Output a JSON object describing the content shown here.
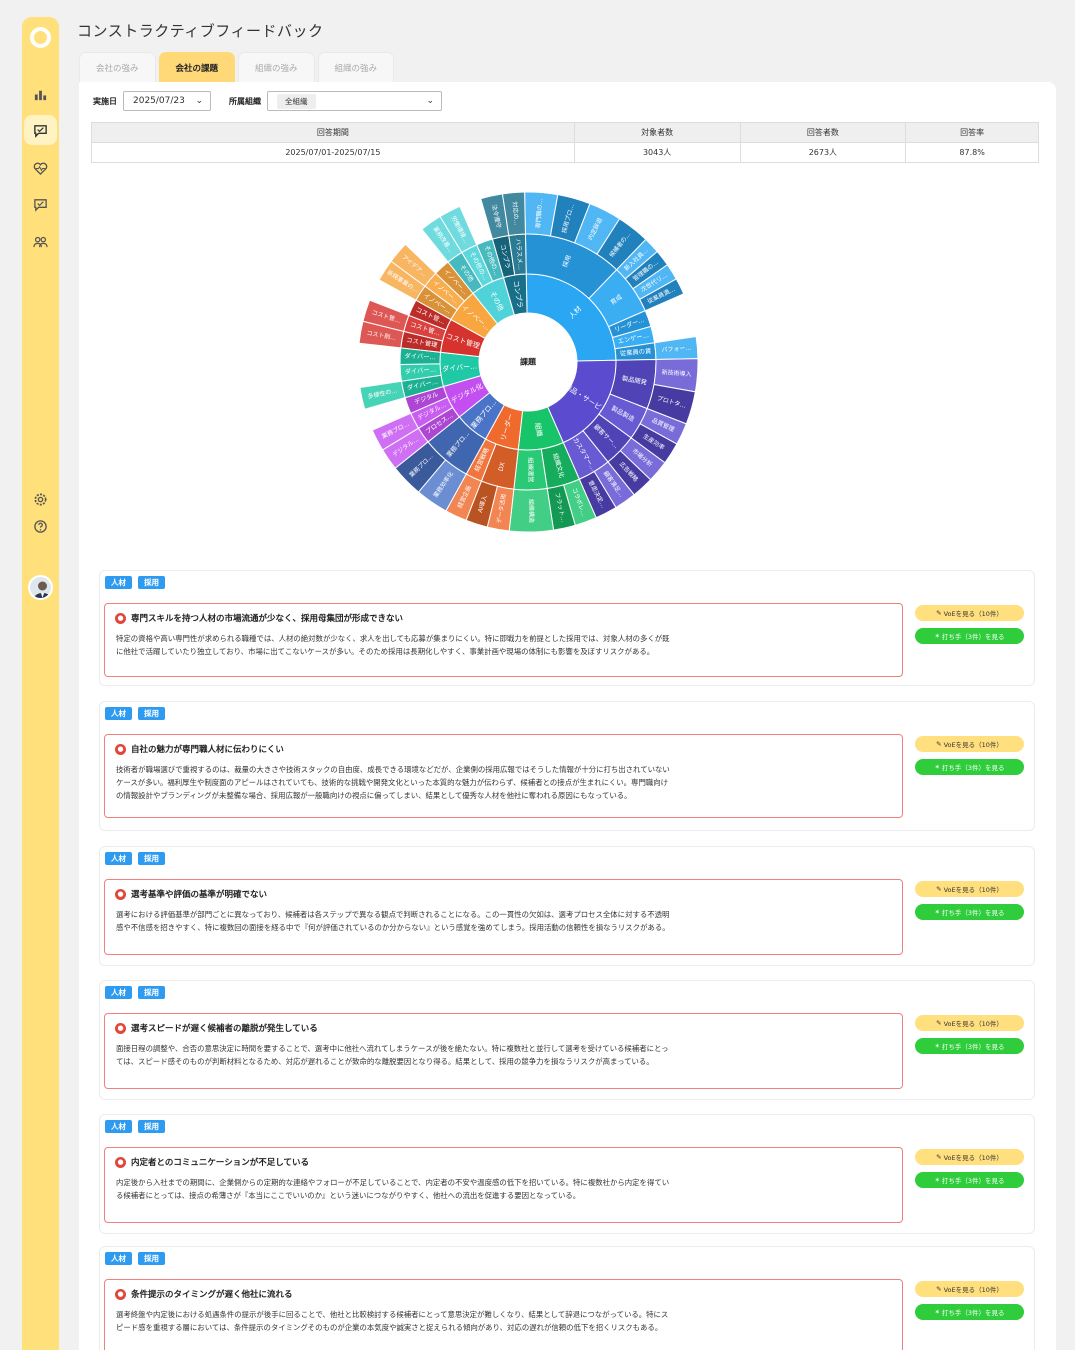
{
  "page_title": "コンストラクティブフィードバック",
  "tabs": [
    {
      "label": "会社の強み",
      "active": false
    },
    {
      "label": "会社の課題",
      "active": true
    },
    {
      "label": "組織の強み",
      "active": false
    },
    {
      "label": "組織の強み",
      "active": false
    }
  ],
  "filters": {
    "date_label": "実施日",
    "date_value": "2025/07/23",
    "org_label": "所属組織",
    "org_value": "全組織"
  },
  "stats": {
    "headers": [
      "回答期間",
      "対象者数",
      "回答者数",
      "回答率"
    ],
    "values": [
      "2025/07/01-2025/07/15",
      "3043人",
      "2673人",
      "87.8%"
    ]
  },
  "sunburst": {
    "center": "課題",
    "inner": [
      {
        "label": "人材",
        "color": "#2aa6f2",
        "weight": 12
      },
      {
        "label": "製品・サービス",
        "color": "#5b4ccf",
        "weight": 9
      },
      {
        "label": "組織",
        "color": "#18c46a",
        "weight": 4
      },
      {
        "label": "リーダー",
        "color": "#ef6a2c",
        "weight": 3
      },
      {
        "label": "業務プロ…",
        "color": "#4a74c8",
        "weight": 3
      },
      {
        "label": "デジタル化",
        "color": "#c44ff0",
        "weight": 3
      },
      {
        "label": "ダイバー…",
        "color": "#1fc9a6",
        "weight": 3
      },
      {
        "label": "コスト管理",
        "color": "#d6322e",
        "weight": 3
      },
      {
        "label": "イノベー…",
        "color": "#f7a640",
        "weight": 3
      },
      {
        "label": "その他",
        "color": "#4fd3d8",
        "weight": 3
      },
      {
        "label": "コンプラ",
        "color": "#186f8a",
        "weight": 2
      }
    ],
    "middle": [
      {
        "label": "採用",
        "parent": 0,
        "weight": 6
      },
      {
        "label": "育成",
        "parent": 0,
        "weight": 3
      },
      {
        "label": "リーダー…",
        "parent": 0,
        "weight": 1
      },
      {
        "label": "エンゲー…",
        "parent": 0,
        "weight": 1
      },
      {
        "label": "従業員の賃",
        "parent": 0,
        "weight": 1
      },
      {
        "label": "製品開発",
        "parent": 1,
        "weight": 3
      },
      {
        "label": "製品製造",
        "parent": 1,
        "weight": 2
      },
      {
        "label": "顧客サー…",
        "parent": 1,
        "weight": 2
      },
      {
        "label": "カスタマー…",
        "parent": 1,
        "weight": 2
      },
      {
        "label": "組織文化",
        "parent": 2,
        "weight": 2
      },
      {
        "label": "組織運営",
        "parent": 2,
        "weight": 2
      },
      {
        "label": "DX",
        "parent": 3,
        "weight": 2
      },
      {
        "label": "経営戦略",
        "parent": 3,
        "weight": 1
      },
      {
        "label": "業務プロ…",
        "parent": 4,
        "weight": 3
      },
      {
        "label": "プロセス…",
        "parent": 5,
        "weight": 1
      },
      {
        "label": "デジタル…",
        "parent": 5,
        "weight": 1
      },
      {
        "label": "デジタル",
        "parent": 5,
        "weight": 1
      },
      {
        "label": "ダイバー…",
        "parent": 6,
        "weight": 1
      },
      {
        "label": "ダイバー…",
        "parent": 6,
        "weight": 1
      },
      {
        "label": "ダイバー…",
        "parent": 6,
        "weight": 1
      },
      {
        "label": "コスト管理",
        "parent": 7,
        "weight": 1
      },
      {
        "label": "コスト管…",
        "parent": 7,
        "weight": 1
      },
      {
        "label": "コスト管…",
        "parent": 7,
        "weight": 1
      },
      {
        "label": "イノベー…",
        "parent": 8,
        "weight": 1
      },
      {
        "label": "イノベー…",
        "parent": 8,
        "weight": 1
      },
      {
        "label": "イノベー…",
        "parent": 8,
        "weight": 1
      },
      {
        "label": "その他",
        "parent": 9,
        "weight": 1
      },
      {
        "label": "その他の…",
        "parent": 9,
        "weight": 1
      },
      {
        "label": "その他の…",
        "parent": 9,
        "weight": 1
      },
      {
        "label": "コンプラ",
        "parent": 10,
        "weight": 1
      },
      {
        "label": "ハラスメ…",
        "parent": 10,
        "weight": 1
      }
    ],
    "outer": [
      {
        "label": "専門職の…",
        "parent": 0,
        "weight": 1
      },
      {
        "label": "採用プロ…",
        "parent": 0,
        "weight": 1
      },
      {
        "label": "内定辞退",
        "parent": 0,
        "weight": 1
      },
      {
        "label": "候補者の…",
        "parent": 0,
        "weight": 1
      },
      {
        "label": "新入社員…",
        "parent": 1,
        "weight": 1
      },
      {
        "label": "管理職の…",
        "parent": 1,
        "weight": 1
      },
      {
        "label": "次世代リ…",
        "parent": 1,
        "weight": 1
      },
      {
        "label": "従業員満…",
        "parent": 1,
        "weight": 1
      },
      {
        "label": "パフォー…",
        "parent": 4,
        "weight": 1
      },
      {
        "label": "新技術導入",
        "parent": 5,
        "weight": 1
      },
      {
        "label": "プロトタ…",
        "parent": 5,
        "weight": 1
      },
      {
        "label": "品質管理",
        "parent": 6,
        "weight": 1
      },
      {
        "label": "生産効率",
        "parent": 6,
        "weight": 1
      },
      {
        "label": "市場分析",
        "parent": 7,
        "weight": 1
      },
      {
        "label": "広告戦略",
        "parent": 7,
        "weight": 1
      },
      {
        "label": "顧客満足…",
        "parent": 8,
        "weight": 1
      },
      {
        "label": "意思決定…",
        "parent": 8,
        "weight": 1
      },
      {
        "label": "コラボレ…",
        "parent": 9,
        "weight": 1
      },
      {
        "label": "フラット…",
        "parent": 9,
        "weight": 1
      },
      {
        "label": "組織構造",
        "parent": 10,
        "weight": 1
      },
      {
        "label": "データ活用",
        "parent": 11,
        "weight": 1
      },
      {
        "label": "AI導入",
        "parent": 11,
        "weight": 1
      },
      {
        "label": "経営企画",
        "parent": 12,
        "weight": 1
      },
      {
        "label": "業務効率化",
        "parent": 13,
        "weight": 1
      },
      {
        "label": "業務プロ…",
        "parent": 13,
        "weight": 1
      },
      {
        "label": "デジタル…",
        "parent": 14,
        "weight": 1
      },
      {
        "label": "業務プロ…",
        "parent": 15,
        "weight": 1
      },
      {
        "label": "多様性の…",
        "parent": 17,
        "weight": 1
      },
      {
        "label": "コスト削…",
        "parent": 20,
        "weight": 1
      },
      {
        "label": "コスト管…",
        "parent": 21,
        "weight": 1
      },
      {
        "label": "新規事業の…",
        "parent": 23,
        "weight": 1
      },
      {
        "label": "アイデア…",
        "parent": 24,
        "weight": 1
      },
      {
        "label": "業務改善…",
        "parent": 26,
        "weight": 1
      },
      {
        "label": "労働環境…",
        "parent": 27,
        "weight": 1
      },
      {
        "label": "法令遵守",
        "parent": 29,
        "weight": 1
      },
      {
        "label": "対応の…",
        "parent": 30,
        "weight": 1
      }
    ]
  },
  "buttons": {
    "voe": "VoEを見る（10件）",
    "action": "打ち手（3件）を見る"
  },
  "cards": [
    {
      "tags": [
        "人材",
        "採用"
      ],
      "title": "専門スキルを持つ人材の市場流通が少なく、採用母集団が形成できない",
      "body": "特定の資格や高い専門性が求められる職種では、人材の絶対数が少なく、求人を出しても応募が集まりにくい。特に即戦力を前提とした採用では、対象人材の多くが既に他社で活躍していたり独立しており、市場に出てこないケースが多い。そのため採用は長期化しやすく、事業計画や現場の体制にも影響を及ぼすリスクがある。"
    },
    {
      "tags": [
        "人材",
        "採用"
      ],
      "title": "自社の魅力が専門職人材に伝わりにくい",
      "body": "技術者が職場選びで重視するのは、裁量の大きさや技術スタックの自由度、成長できる環境などだが、企業側の採用広報ではそうした情報が十分に打ち出されていないケースが多い。福利厚生や制度面のアピールはされていても、技術的な挑戦や開発文化といった本質的な魅力が伝わらず、候補者との接点が生まれにくい。専門職向けの情報設計やブランディングが未整備な場合、採用広報が一般職向けの視点に偏ってしまい、結果として優秀な人材を他社に奪われる原因にもなっている。"
    },
    {
      "tags": [
        "人材",
        "採用"
      ],
      "title": "選考基準や評価の基準が明確でない",
      "body": "選考における評価基準が部門ごとに異なっており、候補者は各ステップで異なる観点で判断されることになる。この一貫性の欠如は、選考プロセス全体に対する不透明感や不信感を招きやすく、特に複数回の面接を経る中で『何が評価されているのか分からない』という感覚を強めてしまう。採用活動の信頼性を損なうリスクがある。"
    },
    {
      "tags": [
        "人材",
        "採用"
      ],
      "title": "選考スピードが遅く候補者の離脱が発生している",
      "body": "面接日程の調整や、合否の意思決定に時間を要することで、選考中に他社へ流れてしまうケースが後を絶たない。特に複数社と並行して選考を受けている候補者にとっては、スピード感そのものが判断材料となるため、対応が遅れることが致命的な離脱要因となり得る。結果として、採用の競争力を損なうリスクが高まっている。"
    },
    {
      "tags": [
        "人材",
        "採用"
      ],
      "title": "内定者とのコミュニケーションが不足している",
      "body": "内定後から入社までの期間に、企業側からの定期的な連絡やフォローが不足していることで、内定者の不安や温度感の低下を招いている。特に複数社から内定を得ている候補者にとっては、接点の希薄さが『本当にここでいいのか』という迷いにつながりやすく、他社への流出を促進する要因となっている。"
    },
    {
      "tags": [
        "人材",
        "採用"
      ],
      "title": "条件提示のタイミングが遅く他社に流れる",
      "body": "選考終盤や内定後における処遇条件の提示が後手に回ることで、他社と比較検討する候補者にとって意思決定が難しくなり、結果として辞退につながっている。特にスピード感を重視する層においては、条件提示のタイミングそのものが企業の本気度や誠実さと捉えられる傾向があり、対応の遅れが信頼の低下を招くリスクもある。"
    }
  ]
}
